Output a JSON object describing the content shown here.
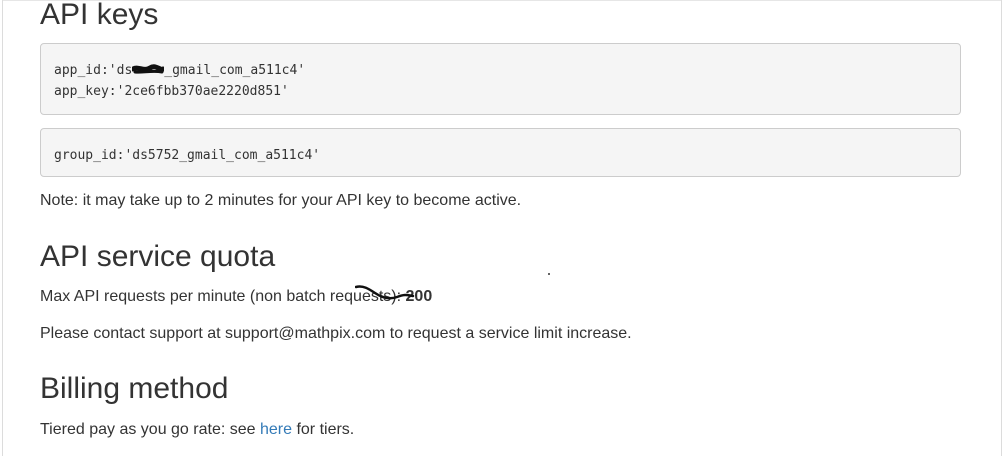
{
  "sections": {
    "api_keys": {
      "heading": "API keys",
      "app_id_prefix": "app_id:'ds",
      "app_id_suffix": "_gmail_com_a511c4'",
      "app_key_line": "app_key:'2ce6fbb370ae2220d851'",
      "group_id_line": "group_id:'ds5752_gmail_com_a511c4'",
      "note": "Note: it may take up to 2 minutes for your API key to become active."
    },
    "quota": {
      "heading": "API service quota",
      "max_label": "Max API requests per minute (non batch requests): ",
      "max_value": "200",
      "contact_text": "Please contact support at support@mathpix.com to request a service limit increase."
    },
    "billing": {
      "heading": "Billing method",
      "tier_prefix": "Tiered pay as you go rate: see ",
      "tier_link": "here",
      "tier_suffix": " for tiers."
    }
  },
  "colors": {
    "text": "#333333",
    "link": "#337ab7",
    "code_bg": "#f5f5f5",
    "code_border": "#cccccc"
  }
}
